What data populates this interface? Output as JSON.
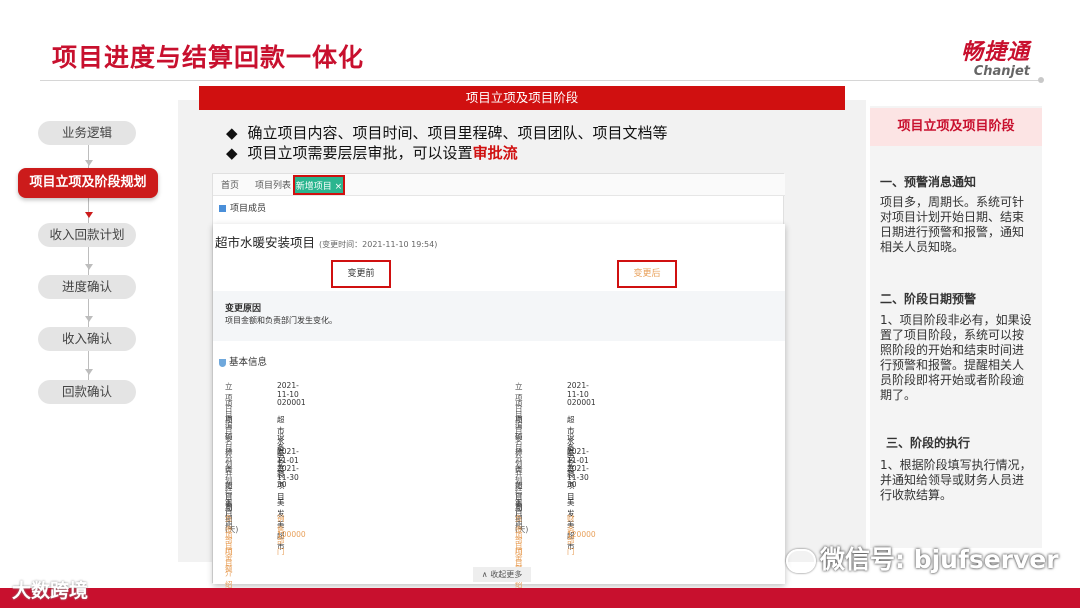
{
  "slide": {
    "title": "项目进度与结算回款一体化",
    "logo_cn": "畅捷通",
    "logo_en": "Chanjet",
    "accent_color": "#c8102e"
  },
  "flow": {
    "steps": [
      "业务逻辑",
      "项目立项及阶段规划",
      "收入回款计划",
      "进度确认",
      "收入确认",
      "回款确认"
    ],
    "active_index": 1
  },
  "center": {
    "banner": "项目立项及项目阶段",
    "bullet1": "确立项目内容、项目时间、项目里程碑、项目团队、项目文档等",
    "bullet2_prefix": "项目立项需要层层审批，可以设置",
    "bullet2_emphasis": "审批流",
    "diamond": "◆"
  },
  "app": {
    "tabs": {
      "home": "首页",
      "list": "项目列表 ×",
      "new": "新增项目 ×"
    },
    "members_label": "项目成员",
    "modal": {
      "title": "超市水暖安装项目",
      "change_time": "(变更时间：2021-11-10 19:54)",
      "before_label": "变更前",
      "after_label": "变更后",
      "reason_title": "变更原因",
      "reason_text": "项目金额和负责部门发生变化。",
      "basic_info_title": "基本信息",
      "before_rows": [
        {
          "k": "立项日期",
          "v": "2021-11-10"
        },
        {
          "k": "项目编码",
          "v": "020001"
        },
        {
          "k": "项目名称",
          "v": "超市水暖安装项目"
        },
        {
          "k": "项目分类",
          "v": "设备安装"
        },
        {
          "k": "计划开始日期",
          "v": "2021-11-01"
        },
        {
          "k": "计划结束日期",
          "v": "2021-11-30"
        },
        {
          "k": "项目周期(天)",
          "v": "30"
        },
        {
          "k": "客户",
          "v": "美发美超市"
        },
        {
          "k": "负责部门",
          "v": "销售部门"
        },
        {
          "k": "项目金额",
          "v": "100000"
        },
        {
          "k": "项目介绍",
          "v": ""
        }
      ],
      "after_rows": [
        {
          "k": "立项日期",
          "v": "2021-11-10"
        },
        {
          "k": "项目编码",
          "v": "020001"
        },
        {
          "k": "项目名称",
          "v": "超市水暖安装项目"
        },
        {
          "k": "项目分类",
          "v": "设备安装"
        },
        {
          "k": "计划开始日期",
          "v": "2021-11-01"
        },
        {
          "k": "计划结束日期",
          "v": "2021-11-30"
        },
        {
          "k": "项目周期(天)",
          "v": "30"
        },
        {
          "k": "客户",
          "v": "美发美超市"
        },
        {
          "k": "负责部门",
          "v": "财务部门"
        },
        {
          "k": "项目金额",
          "v": "120000"
        },
        {
          "k": "项目介绍",
          "v": ""
        }
      ],
      "collapse_label": "∧ 收起更多"
    }
  },
  "right": {
    "header": "项目立项及项目阶段",
    "sections": [
      {
        "heading": "一、预警消息通知",
        "text": "项目多，周期长。系统可针对项目计划开始日期、结束日期进行预警和报警，通知相关人员知晓。"
      },
      {
        "heading": "二、阶段日期预警",
        "text": "1、项目阶段非必有，如果设置了项目阶段，系统可以按照阶段的开始和结束时间进行预警和报警。提醒相关人员阶段即将开始或者阶段逾期了。"
      },
      {
        "heading": "三、阶段的执行",
        "text": "1、根据阶段填写执行情况，并通知给领导或财务人员进行收款结算。"
      }
    ]
  },
  "footer": {
    "watermark": "微信号: bjufserver",
    "source": "大数跨境"
  }
}
